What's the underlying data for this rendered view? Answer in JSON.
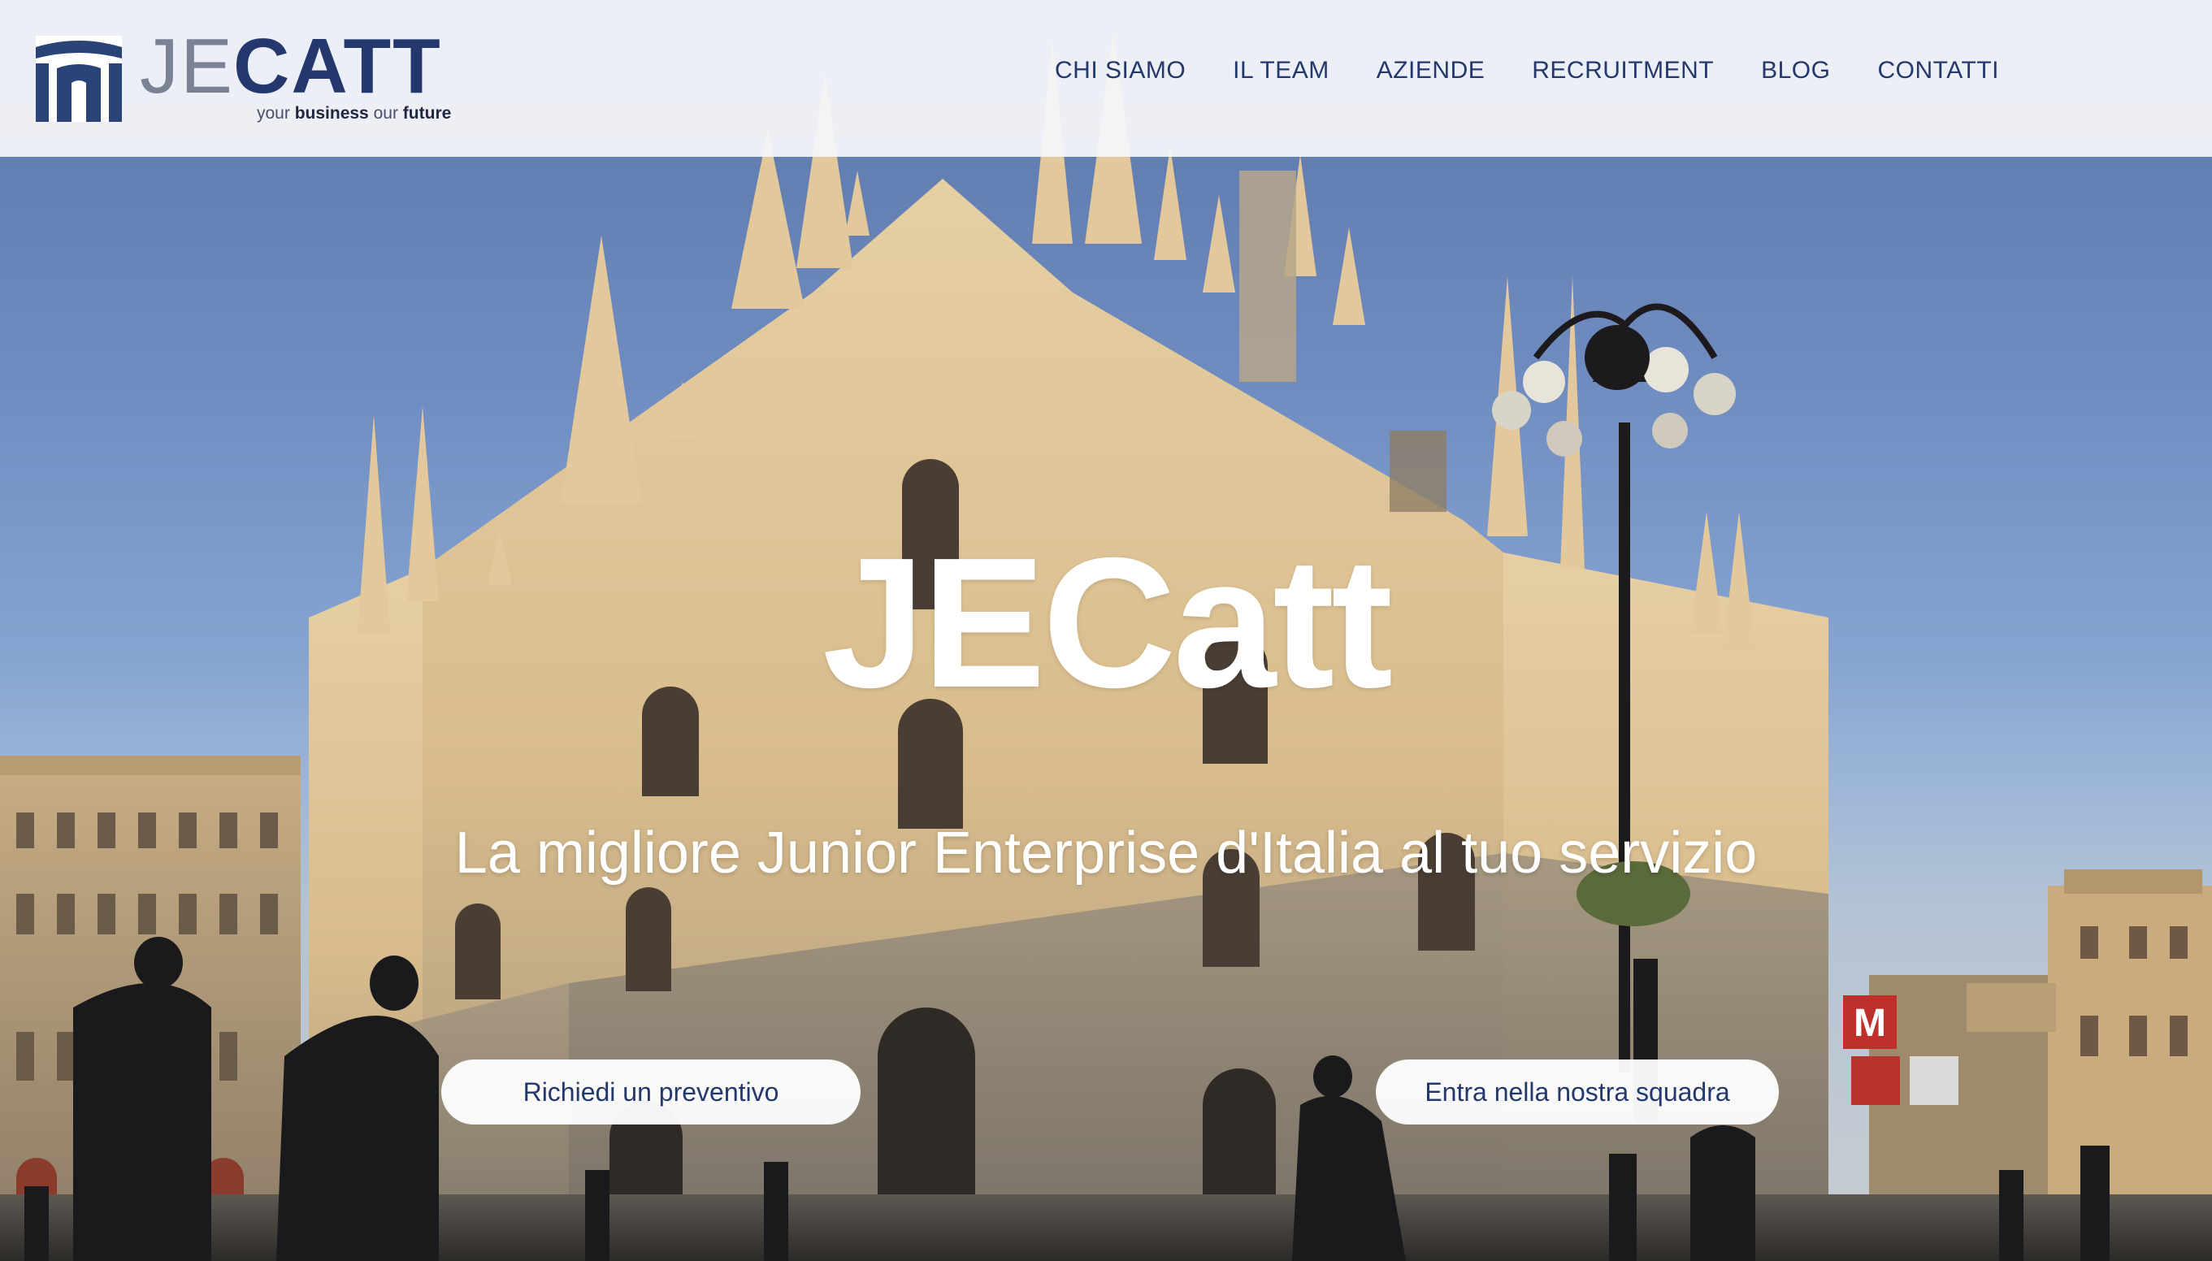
{
  "header": {
    "logo": {
      "je": "JE",
      "catt": "CATT",
      "tagline_your": "your",
      "tagline_business": "business",
      "tagline_our": "our",
      "tagline_future": "future"
    },
    "nav": [
      {
        "label": "CHI SIAMO"
      },
      {
        "label": "IL TEAM"
      },
      {
        "label": "AZIENDE"
      },
      {
        "label": "RECRUITMENT"
      },
      {
        "label": "BLOG"
      },
      {
        "label": "CONTATTI"
      }
    ]
  },
  "hero": {
    "title": "JECatt",
    "subtitle": "La migliore Junior Enterprise d'Italia al tuo servizio",
    "buttons": {
      "quote": "Richiedi un preventivo",
      "join": "Entra nella nostra squadra"
    },
    "background_icon": "milan-duomo-photo"
  },
  "colors": {
    "brand_navy": "#24386d",
    "header_bg": "#f5f7fa",
    "text_white": "#ffffff"
  }
}
